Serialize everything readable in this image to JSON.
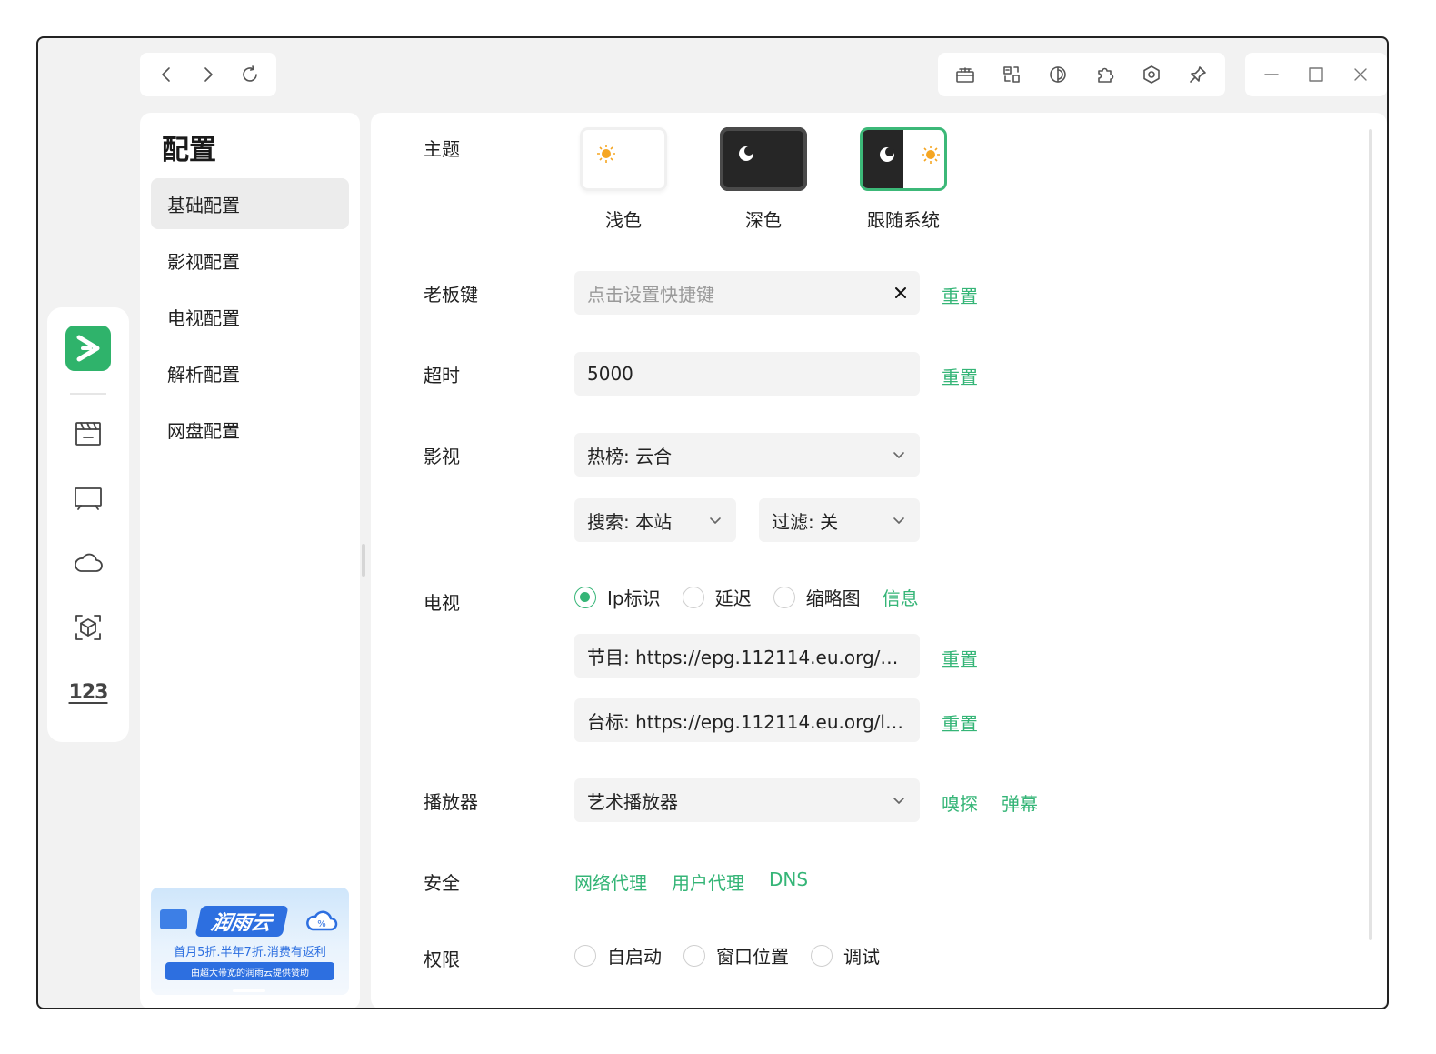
{
  "titlebar": {
    "nav": [
      "back-icon",
      "forward-icon",
      "refresh-icon"
    ],
    "tools": [
      "gift-icon",
      "translate-icon",
      "contrast-icon",
      "puzzle-icon",
      "settings-icon",
      "pin-icon"
    ],
    "window": [
      "minimize-icon",
      "maximize-icon",
      "close-icon"
    ]
  },
  "leftbar": {
    "brand_color": "#2fb36b",
    "icons": [
      "movie-icon",
      "tv-icon",
      "cloud-icon",
      "scan-cube-icon",
      "number-icon"
    ],
    "number_label": "123"
  },
  "menu": {
    "title": "配置",
    "items": [
      {
        "label": "基础配置",
        "active": true
      },
      {
        "label": "影视配置",
        "active": false
      },
      {
        "label": "电视配置",
        "active": false
      },
      {
        "label": "解析配置",
        "active": false
      },
      {
        "label": "网盘配置",
        "active": false
      }
    ],
    "ad": {
      "brand": "润雨云",
      "line1": "首月5折.半年7折.消费有返利",
      "line2": "由超大带宽的润雨云提供赞助"
    }
  },
  "settings": {
    "theme": {
      "label": "主题",
      "options": [
        {
          "label": "浅色",
          "selected": false
        },
        {
          "label": "深色",
          "selected": false
        },
        {
          "label": "跟随系统",
          "selected": true
        }
      ],
      "accent": "#3cb878"
    },
    "boss_key": {
      "label": "老板键",
      "placeholder": "点击设置快捷键",
      "reset": "重置"
    },
    "timeout": {
      "label": "超时",
      "value": "5000",
      "reset": "重置"
    },
    "film": {
      "label": "影视",
      "hot": "热榜: 云合",
      "search": "搜索: 本站",
      "filter": "过滤: 关"
    },
    "tv": {
      "label": "电视",
      "radios": [
        {
          "label": "Ip标识",
          "checked": true
        },
        {
          "label": "延迟",
          "checked": false
        },
        {
          "label": "缩略图",
          "checked": false
        }
      ],
      "info": "信息",
      "epg": "节目: https://epg.112114.eu.org/?c...",
      "logo": "台标: https://epg.112114.eu.org/lo...",
      "reset": "重置"
    },
    "player": {
      "label": "播放器",
      "value": "艺术播放器",
      "sniff": "嗅探",
      "danmaku": "弹幕"
    },
    "security": {
      "label": "安全",
      "links": [
        "网络代理",
        "用户代理",
        "DNS"
      ]
    },
    "permission": {
      "label": "权限",
      "radios": [
        {
          "label": "自启动",
          "checked": false
        },
        {
          "label": "窗口位置",
          "checked": false
        },
        {
          "label": "调试",
          "checked": false
        }
      ]
    }
  },
  "colors": {
    "accent": "#35b577",
    "window_bg": "#f2f2f2",
    "field_bg": "#f3f3f3"
  }
}
